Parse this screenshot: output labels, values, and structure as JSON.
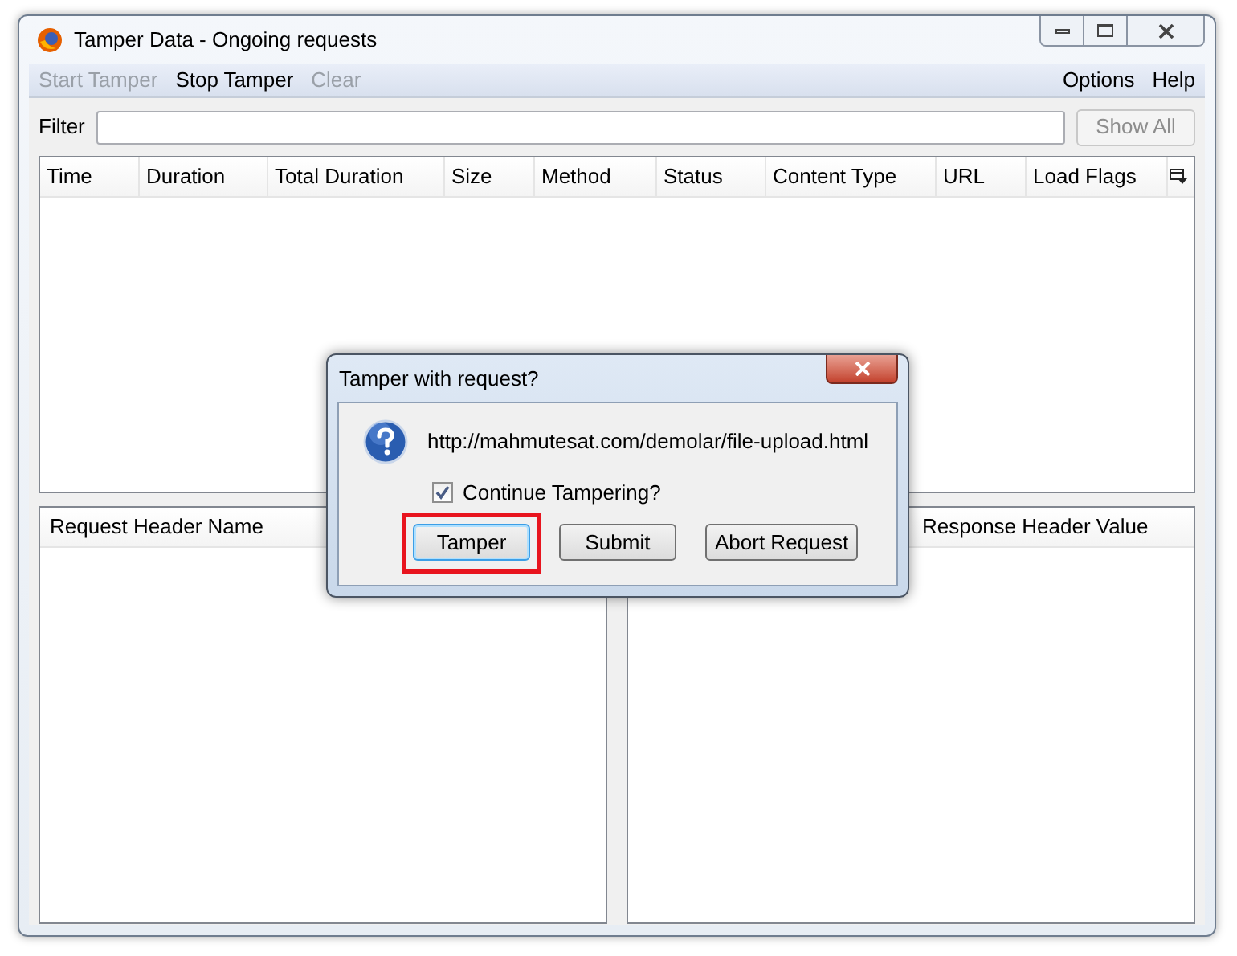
{
  "window": {
    "title": "Tamper Data - Ongoing requests"
  },
  "menu": {
    "left": [
      {
        "label": "Start Tamper",
        "disabled": true
      },
      {
        "label": "Stop Tamper",
        "disabled": false
      },
      {
        "label": "Clear",
        "disabled": true
      }
    ],
    "right": [
      {
        "label": "Options",
        "disabled": false
      },
      {
        "label": "Help",
        "disabled": false
      }
    ]
  },
  "filter": {
    "label": "Filter",
    "button": {
      "label": "Show All",
      "disabled": true
    }
  },
  "table": {
    "columns": [
      "Time",
      "Duration",
      "Total Duration",
      "Size",
      "Method",
      "Status",
      "Content Type",
      "URL",
      "Load Flags"
    ]
  },
  "request_headers": {
    "columns": [
      "Request Header Name"
    ]
  },
  "response_headers": {
    "columns": [
      "Response Header Value"
    ]
  },
  "dialog": {
    "title": "Tamper with request?",
    "url": "http://mahmutesat.com/demolar/file-upload.html",
    "checkbox": {
      "label": "Continue Tampering?",
      "checked": true
    },
    "buttons": [
      {
        "label": "Tamper",
        "highlighted": true,
        "selected": true
      },
      {
        "label": "Submit",
        "highlighted": false,
        "selected": false
      },
      {
        "label": "Abort Request",
        "highlighted": false,
        "selected": false
      }
    ]
  }
}
